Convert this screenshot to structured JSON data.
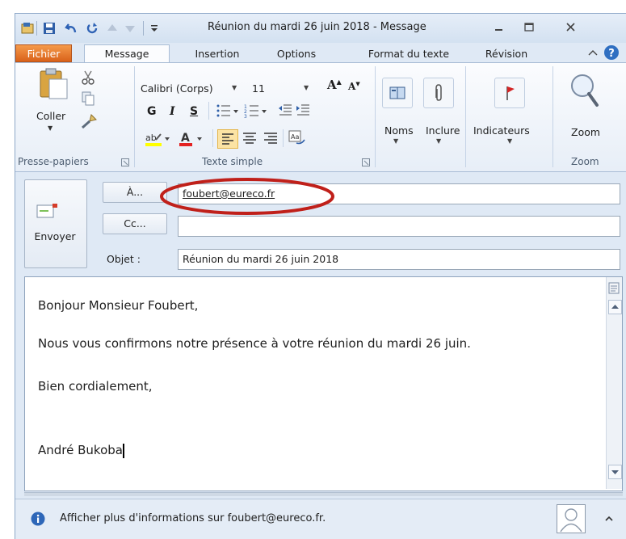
{
  "window": {
    "title": "Réunion du mardi 26 juin 2018  -  Message"
  },
  "tabs": [
    {
      "label": "Fichier"
    },
    {
      "label": "Message"
    },
    {
      "label": "Insertion"
    },
    {
      "label": "Options"
    },
    {
      "label": "Format du texte"
    },
    {
      "label": "Révision"
    }
  ],
  "ribbon": {
    "clipboard": {
      "paste": "Coller",
      "group": "Presse-papiers"
    },
    "font": {
      "name": "Calibri (Corps)",
      "size": "11",
      "bold": "G",
      "italic": "I",
      "underline": "S",
      "group": "Texte simple"
    },
    "names": "Noms",
    "include": "Inclure",
    "flags": "Indicateurs",
    "zoom": "Zoom",
    "zoom_group": "Zoom"
  },
  "compose": {
    "send": "Envoyer",
    "to_button": "À...",
    "cc_button": "Cc...",
    "subject_label": "Objet :",
    "to_value": "foubert@eureco.fr",
    "cc_value": "",
    "subject_value": "Réunion du mardi 26 juin 2018"
  },
  "body": {
    "lines": [
      "Bonjour Monsieur Foubert,",
      "Nous vous confirmons notre présence à votre réunion du mardi 26 juin.",
      "Bien cordialement,",
      "André Bukoba"
    ]
  },
  "infobar": {
    "text": "Afficher plus d'informations sur foubert@eureco.fr."
  },
  "colors": {
    "file_tab": "#e1722b",
    "accent": "#2f6fc1",
    "annotation": "#c0201a"
  }
}
